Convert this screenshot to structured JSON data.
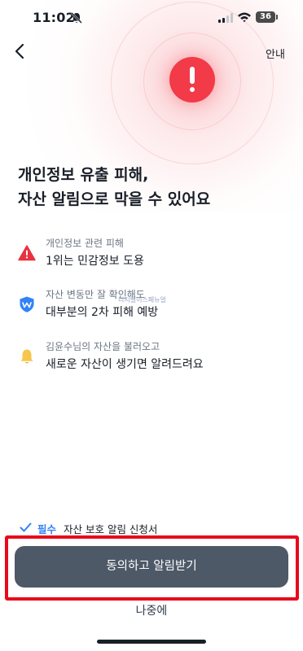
{
  "status_bar": {
    "time": "11:02",
    "battery": "36"
  },
  "header": {
    "guide_label": "안내"
  },
  "headline": {
    "line1": "개인정보 유출 피해,",
    "line2": "자산 알림으로 막을 수 있어요"
  },
  "features": [
    {
      "icon": "warning-icon",
      "sub": "개인정보 관련 피해",
      "main": "1위는 민감정보 도용"
    },
    {
      "icon": "shield-icon",
      "sub": "자산 변동만 잘 확인해도",
      "main": "대부분의 2차 피해 예방"
    },
    {
      "icon": "bell-icon",
      "sub": "김윤수님의 자산을 불러오고",
      "main": "새로운 자산이 생기면 알려드려요"
    }
  ],
  "watermark": "디지털이스페뉴얼",
  "consent": {
    "required_label": "필수",
    "label": "자산 보호 알림 신청서"
  },
  "primary_button_label": "동의하고 알림받기",
  "later_button_label": "나중에",
  "colors": {
    "alert_red": "#f23a49",
    "primary_button": "#4e5968",
    "accent_blue": "#3182f6",
    "highlight_border": "#e8091a",
    "warning_icon": "#e8343f",
    "bell_icon": "#f7c64a"
  }
}
